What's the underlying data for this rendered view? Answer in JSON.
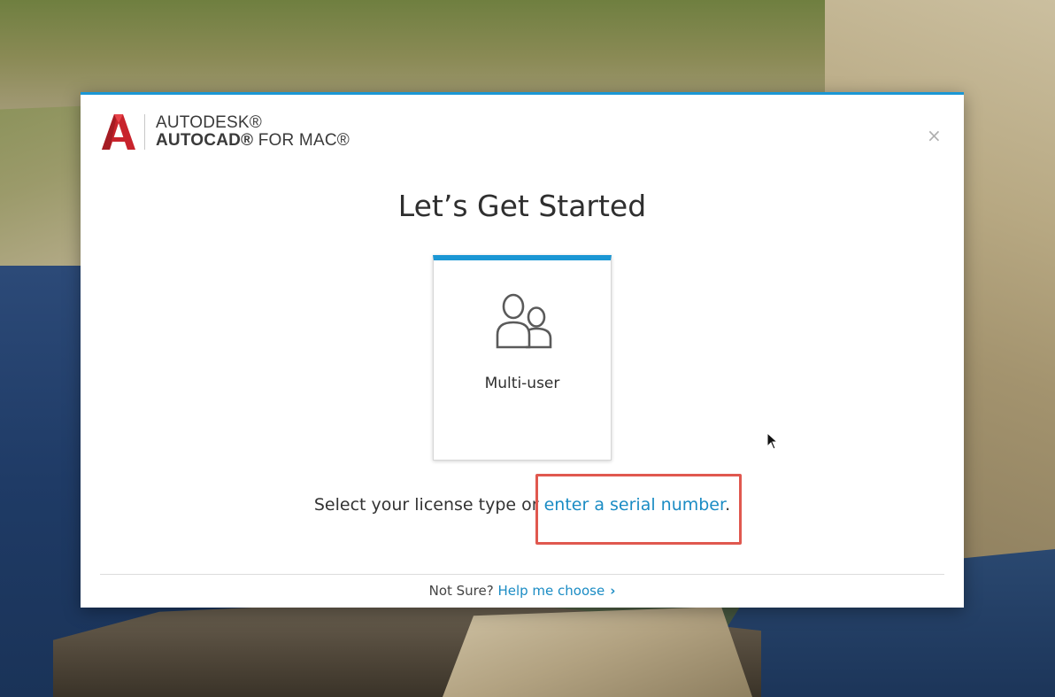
{
  "background": {
    "description_colors": {
      "accent": "#1b97d4",
      "highlight": "#e0584f",
      "link": "#1b8cc4"
    }
  },
  "dialog": {
    "logo": {
      "icon": "autocad-a-logo",
      "line1": "AUTODESK®",
      "line2_bold": "AUTOCAD®",
      "line2_rest": " FOR MAC®"
    },
    "close_label": "×",
    "title": "Let’s Get Started",
    "card": {
      "icon": "multi-user-icon",
      "label": "Multi-user"
    },
    "prompt": {
      "text_before": "Select your license type or ",
      "link": "enter a serial number",
      "text_after": "."
    },
    "footer": {
      "text": "Not Sure? ",
      "link": "Help me choose",
      "chevron": "›"
    }
  }
}
